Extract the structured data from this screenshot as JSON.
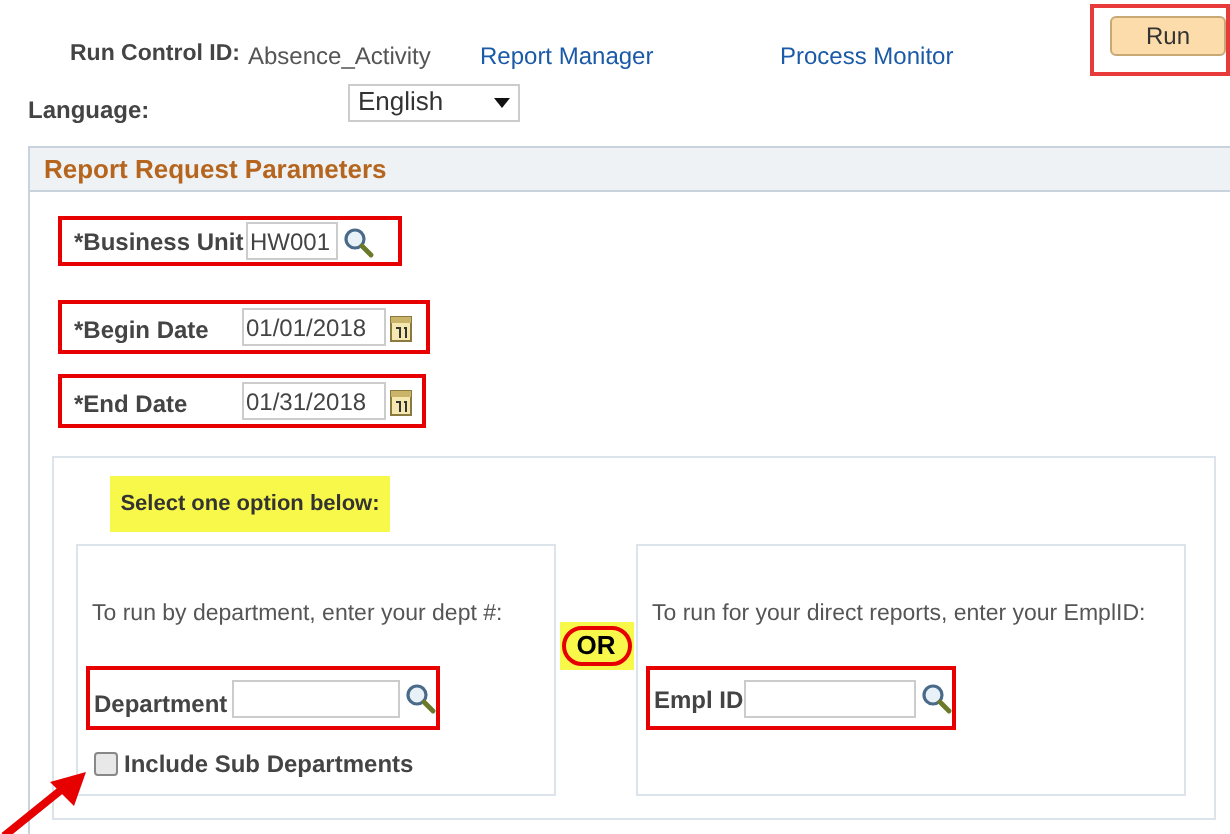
{
  "header": {
    "run_control_label": "Run Control ID:",
    "run_control_value": "Absence_Activity",
    "links": [
      "Report Manager",
      "Process Monitor"
    ],
    "run_button": "Run"
  },
  "language": {
    "label": "Language:",
    "value": "English"
  },
  "panel": {
    "title": "Report Request Parameters",
    "fields": [
      {
        "label": "*Business Unit",
        "value": "HW001",
        "kind": "lookup"
      },
      {
        "label": "*Begin Date",
        "value": "01/01/2018",
        "kind": "date"
      },
      {
        "label": "*End Date",
        "value": "01/31/2018",
        "kind": "date"
      }
    ],
    "options": {
      "heading": "Select one option below:",
      "separator": "OR",
      "left": {
        "instruction": "To run by department, enter your dept #:",
        "field_label": "Department",
        "checkbox": {
          "label": "Include Sub Departments",
          "checked": false
        }
      },
      "right": {
        "instruction": "To run for your direct reports, enter your EmplID:",
        "field_label": "Empl ID"
      }
    }
  }
}
